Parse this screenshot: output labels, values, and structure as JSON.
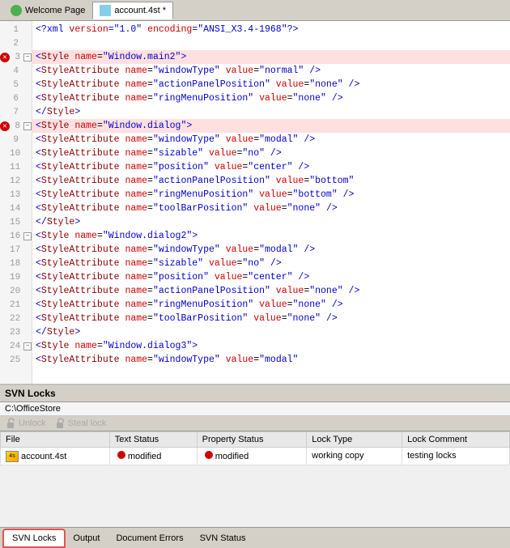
{
  "tabs": [
    {
      "id": "welcome",
      "label": "Welcome Page",
      "icon": "green-circle",
      "active": false
    },
    {
      "id": "account",
      "label": "account.4st *",
      "icon": "file-blue",
      "active": true
    }
  ],
  "editor": {
    "lines": [
      {
        "num": 1,
        "indent": 0,
        "error": false,
        "expand": false,
        "code": "<?xml version=\"1.0\" encoding=\"ANSI_X3.4-1968\"?>"
      },
      {
        "num": 2,
        "indent": 0,
        "error": false,
        "expand": false,
        "code": ""
      },
      {
        "num": 3,
        "indent": 0,
        "error": true,
        "expand": true,
        "code": "  <Style name=\"Window.main2\">"
      },
      {
        "num": 4,
        "indent": 1,
        "error": false,
        "expand": false,
        "code": "    <StyleAttribute name=\"windowType\" value=\"normal\" />"
      },
      {
        "num": 5,
        "indent": 1,
        "error": false,
        "expand": false,
        "code": "    <StyleAttribute name=\"actionPanelPosition\" value=\"none\" />"
      },
      {
        "num": 6,
        "indent": 1,
        "error": false,
        "expand": false,
        "code": "    <StyleAttribute name=\"ringMenuPosition\" value=\"none\" />"
      },
      {
        "num": 7,
        "indent": 1,
        "error": false,
        "expand": false,
        "code": "  </Style>"
      },
      {
        "num": 8,
        "indent": 0,
        "error": true,
        "expand": true,
        "code": "  <Style name=\"Window.dialog\">"
      },
      {
        "num": 9,
        "indent": 1,
        "error": false,
        "expand": false,
        "code": "    <StyleAttribute name=\"windowType\" value=\"modal\" />"
      },
      {
        "num": 10,
        "indent": 1,
        "error": false,
        "expand": false,
        "code": "    <StyleAttribute name=\"sizable\" value=\"no\" />"
      },
      {
        "num": 11,
        "indent": 1,
        "error": false,
        "expand": false,
        "code": "    <StyleAttribute name=\"position\" value=\"center\" />"
      },
      {
        "num": 12,
        "indent": 1,
        "error": false,
        "expand": false,
        "code": "    <StyleAttribute name=\"actionPanelPosition\" value=\"bottom\""
      },
      {
        "num": 13,
        "indent": 1,
        "error": false,
        "expand": false,
        "code": "    <StyleAttribute name=\"ringMenuPosition\" value=\"bottom\" />"
      },
      {
        "num": 14,
        "indent": 1,
        "error": false,
        "expand": false,
        "code": "    <StyleAttribute name=\"toolBarPosition\" value=\"none\" />"
      },
      {
        "num": 15,
        "indent": 1,
        "error": false,
        "expand": false,
        "code": "  </Style>"
      },
      {
        "num": 16,
        "indent": 0,
        "error": false,
        "expand": true,
        "code": "  <Style name=\"Window.dialog2\">"
      },
      {
        "num": 17,
        "indent": 1,
        "error": false,
        "expand": false,
        "code": "    <StyleAttribute name=\"windowType\" value=\"modal\" />"
      },
      {
        "num": 18,
        "indent": 1,
        "error": false,
        "expand": false,
        "code": "    <StyleAttribute name=\"sizable\" value=\"no\" />"
      },
      {
        "num": 19,
        "indent": 1,
        "error": false,
        "expand": false,
        "code": "    <StyleAttribute name=\"position\" value=\"center\" />"
      },
      {
        "num": 20,
        "indent": 1,
        "error": false,
        "expand": false,
        "code": "    <StyleAttribute name=\"actionPanelPosition\" value=\"none\" />"
      },
      {
        "num": 21,
        "indent": 1,
        "error": false,
        "expand": false,
        "code": "    <StyleAttribute name=\"ringMenuPosition\" value=\"none\" />"
      },
      {
        "num": 22,
        "indent": 1,
        "error": false,
        "expand": false,
        "code": "    <StyleAttribute name=\"toolBarPosition\" value=\"none\" />"
      },
      {
        "num": 23,
        "indent": 1,
        "error": false,
        "expand": false,
        "code": "  </Style>"
      },
      {
        "num": 24,
        "indent": 0,
        "error": false,
        "expand": true,
        "code": "  <Style name=\"Window.dialog3\">"
      },
      {
        "num": 25,
        "indent": 1,
        "error": false,
        "expand": false,
        "code": "    <StyleAttribute name=\"windowType\" value=\"modal\""
      }
    ]
  },
  "svn_locks": {
    "title": "SVN Locks",
    "path": "C:\\OfficeStore",
    "toolbar": {
      "unlock_label": "Unlock",
      "steal_lock_label": "Steal lock"
    },
    "table": {
      "columns": [
        "File",
        "Text Status",
        "Property Status",
        "Lock Type",
        "Lock Comment"
      ],
      "rows": [
        {
          "file": "account.4st",
          "text_status": "modified",
          "property_status": "modified",
          "lock_type": "working copy",
          "lock_comment": "testing locks"
        }
      ]
    }
  },
  "bottom_tabs": [
    {
      "id": "svn-locks",
      "label": "SVN Locks",
      "active": true
    },
    {
      "id": "output",
      "label": "Output",
      "active": false
    },
    {
      "id": "document-errors",
      "label": "Document Errors",
      "active": false
    },
    {
      "id": "svn-status",
      "label": "SVN Status",
      "active": false
    }
  ],
  "colors": {
    "error_red": "#cc0000",
    "active_tab_outline": "#e05555",
    "xml_blue": "#0000cc",
    "tag_darkred": "#8b0000",
    "attr_red": "#cc0000"
  }
}
